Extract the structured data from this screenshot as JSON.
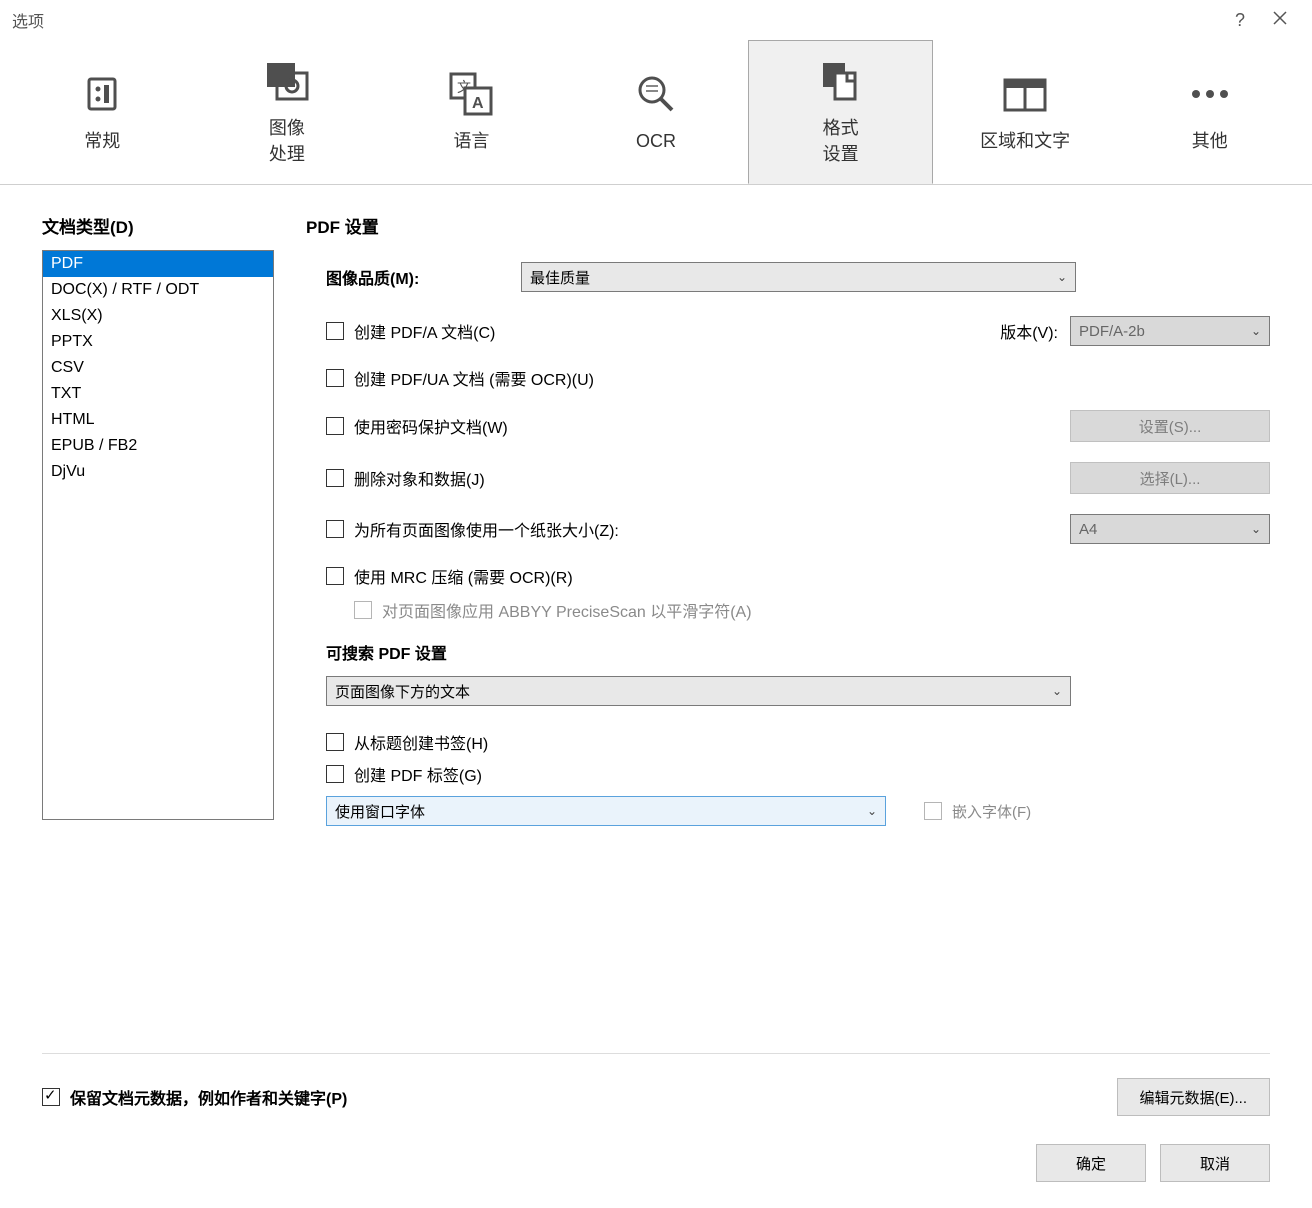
{
  "window": {
    "title": "选项"
  },
  "tabs": [
    {
      "label": "常规"
    },
    {
      "label": "图像\n处理"
    },
    {
      "label": "语言"
    },
    {
      "label": "OCR"
    },
    {
      "label": "格式\n设置"
    },
    {
      "label": "区域和文字"
    },
    {
      "label": "其他"
    }
  ],
  "sidebar": {
    "title": "文档类型(D)",
    "items": [
      "PDF",
      "DOC(X) / RTF / ODT",
      "XLS(X)",
      "PPTX",
      "CSV",
      "TXT",
      "HTML",
      "EPUB / FB2",
      "DjVu"
    ]
  },
  "main": {
    "title": "PDF 设置",
    "imageQuality": {
      "label": "图像品质(M):",
      "value": "最佳质量"
    },
    "createPdfA": {
      "label": "创建 PDF/A 文档(C)"
    },
    "version": {
      "label": "版本(V):",
      "value": "PDF/A-2b"
    },
    "createPdfUA": {
      "label": "创建 PDF/UA 文档 (需要 OCR)(U)"
    },
    "passwordProtect": {
      "label": "使用密码保护文档(W)",
      "button": "设置(S)..."
    },
    "deleteObjects": {
      "label": "删除对象和数据(J)",
      "button": "选择(L)..."
    },
    "paperSize": {
      "label": "为所有页面图像使用一个纸张大小(Z):",
      "value": "A4"
    },
    "mrc": {
      "label": "使用 MRC 压缩 (需要 OCR)(R)"
    },
    "preciseScan": {
      "label": "对页面图像应用 ABBYY PreciseScan 以平滑字符(A)"
    },
    "searchableTitle": "可搜索 PDF 设置",
    "searchableSelect": {
      "value": "页面图像下方的文本"
    },
    "bookmarks": {
      "label": "从标题创建书签(H)"
    },
    "pdfTags": {
      "label": "创建 PDF 标签(G)"
    },
    "fontSelect": {
      "value": "使用窗口字体"
    },
    "embedFonts": {
      "label": "嵌入字体(F)"
    }
  },
  "footer": {
    "metadata": {
      "label": "保留文档元数据，例如作者和关键字(P)"
    },
    "editMetadata": {
      "label": "编辑元数据(E)..."
    },
    "ok": "确定",
    "cancel": "取消"
  }
}
